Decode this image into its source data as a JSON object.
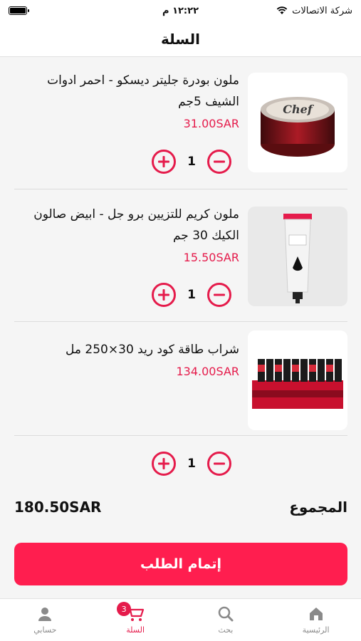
{
  "status_bar": {
    "carrier": "شركة الاتصالات",
    "time": "١٢:٢٢ م"
  },
  "header": {
    "title": "السلة"
  },
  "cart": {
    "items": [
      {
        "name": "ملون بودرة جليتر ديسكو - احمر ادوات الشيف 5جم",
        "price": "31.00SAR",
        "quantity": "1"
      },
      {
        "name": "ملون كريم للتزيين برو جل - ابيض صالون الكيك 30 جم",
        "price": "15.50SAR",
        "quantity": "1"
      },
      {
        "name": "شراب طاقة كود ريد 30×250 مل",
        "price": "134.00SAR",
        "quantity": "1"
      }
    ]
  },
  "summary": {
    "total_label": "المجموع",
    "total_value": "180.50SAR"
  },
  "checkout": {
    "label": "إتمام الطلب"
  },
  "tabbar": {
    "items": [
      {
        "label": "الرئيسية",
        "icon": "home-icon"
      },
      {
        "label": "بحث",
        "icon": "search-icon"
      },
      {
        "label": "السلة",
        "icon": "cart-icon",
        "badge": "3"
      },
      {
        "label": "حسابي",
        "icon": "user-icon"
      }
    ]
  },
  "colors": {
    "accent": "#e51b4b",
    "button": "#ff1e4f"
  }
}
